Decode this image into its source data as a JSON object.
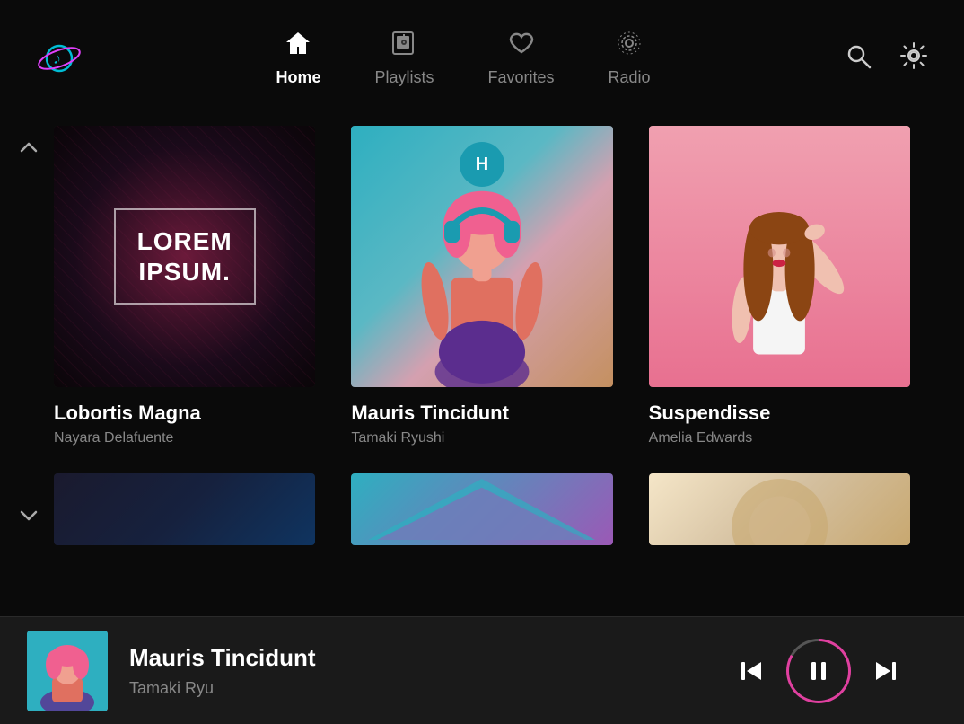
{
  "app": {
    "logo_text": "🎵"
  },
  "nav": {
    "tabs": [
      {
        "id": "home",
        "label": "Home",
        "active": true
      },
      {
        "id": "playlists",
        "label": "Playlists",
        "active": false
      },
      {
        "id": "favorites",
        "label": "Favorites",
        "active": false
      },
      {
        "id": "radio",
        "label": "Radio",
        "active": false
      }
    ],
    "search_label": "Search",
    "settings_label": "Settings"
  },
  "scroll": {
    "up_arrow": "∧",
    "down_arrow": "∨"
  },
  "cards": [
    {
      "id": "card-1",
      "thumb_text_line1": "LOREM",
      "thumb_text_line2": "IPSUM.",
      "title": "Lobortis Magna",
      "artist": "Nayara Delafuente"
    },
    {
      "id": "card-2",
      "title": "Mauris Tincidunt",
      "artist": "Tamaki Ryushi"
    },
    {
      "id": "card-3",
      "title": "Suspendisse",
      "artist": "Amelia Edwards"
    }
  ],
  "player": {
    "title": "Mauris Tincidunt",
    "artist": "Tamaki Ryu",
    "prev_label": "⏮",
    "pause_label": "⏸",
    "next_label": "⏭"
  }
}
